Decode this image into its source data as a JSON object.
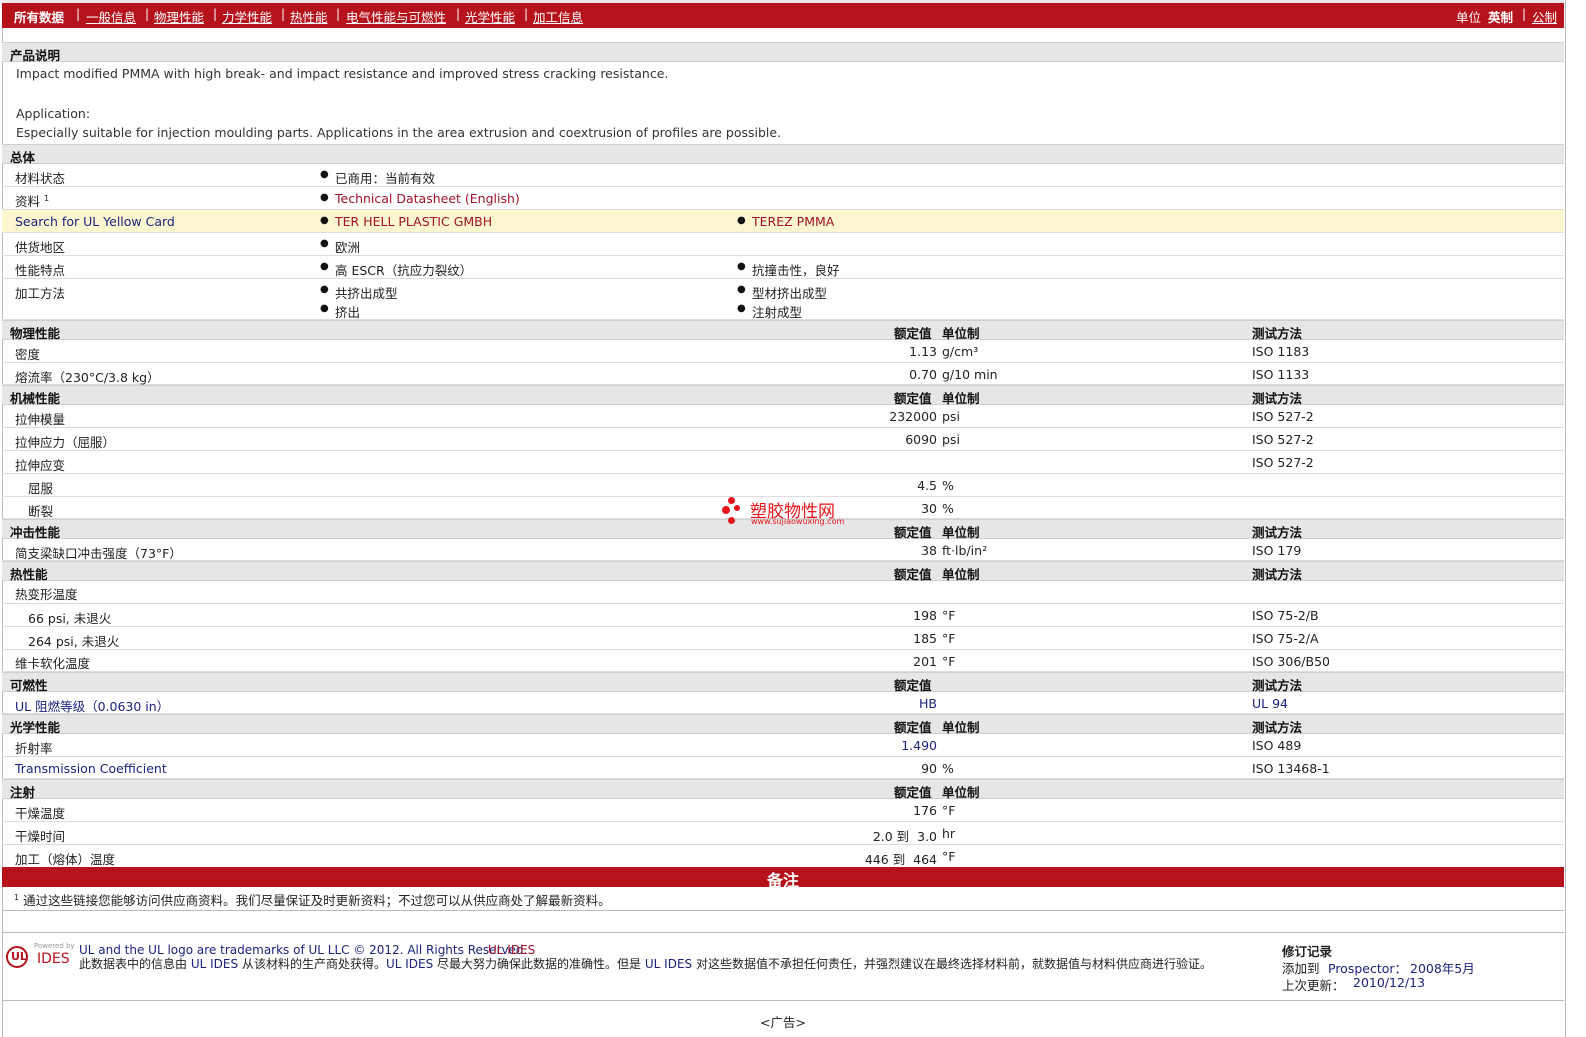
{
  "nav": {
    "items": [
      "所有数据",
      "一般信息",
      "物理性能",
      "力学性能",
      "热性能",
      "电气性能与可燃性",
      "光学性能",
      "加工信息"
    ],
    "separator": "|",
    "unit_label": "单位",
    "unit_imperial": "英制",
    "unit_metric": "公制"
  },
  "description": {
    "title": "产品说明",
    "line1": "Impact modified PMMA with high break- and impact resistance and improved stress cracking resistance.",
    "line2": "Application:",
    "line3": "Especially suitable for injection moulding parts. Applications in the area extrusion and coextrusion of profiles are possible."
  },
  "general": {
    "title": "总体",
    "rows": [
      {
        "label": "材料状态",
        "values": [
          "已商用：当前有效"
        ]
      },
      {
        "label": "资料",
        "sup": "1",
        "values": [
          "Technical Datasheet (English)"
        ]
      },
      {
        "label": "Search for UL Yellow Card",
        "values": [
          "TER HELL PLASTIC GMBH",
          "TEREZ PMMA"
        ]
      },
      {
        "label": "供货地区",
        "values": [
          "欧洲"
        ]
      },
      {
        "label": "性能特点",
        "values": [
          "高 ESCR（抗应力裂纹）",
          "抗撞击性，良好"
        ]
      },
      {
        "label": "加工方法",
        "values": [
          "共挤出成型",
          "型材挤出成型",
          "挤出",
          "注射成型"
        ]
      }
    ]
  },
  "columns": {
    "nominal": "额定值",
    "unit": "单位制",
    "method": "测试方法"
  },
  "physical": {
    "title": "物理性能",
    "rows": [
      {
        "label": "密度",
        "value": "1.13",
        "unit": "g/cm³",
        "method": "ISO 1183"
      },
      {
        "label": "熔流率（230°C/3.8 kg）",
        "value": "0.70",
        "unit": "g/10 min",
        "method": "ISO 1133"
      }
    ]
  },
  "mechanical": {
    "title": "机械性能",
    "rows": [
      {
        "label": "拉伸模量",
        "value": "232000",
        "unit": "psi",
        "method": "ISO 527-2"
      },
      {
        "label": "拉伸应力（屈服）",
        "value": "6090",
        "unit": "psi",
        "method": "ISO 527-2"
      },
      {
        "label": "拉伸应变",
        "value": "",
        "unit": "",
        "method": "ISO 527-2"
      },
      {
        "label": "屈服",
        "value": "4.5",
        "unit": "%",
        "method": ""
      },
      {
        "label": "断裂",
        "value": "30",
        "unit": "%",
        "method": ""
      }
    ]
  },
  "impact": {
    "title": "冲击性能",
    "rows": [
      {
        "label": "简支梁缺口冲击强度（73°F）",
        "value": "38",
        "unit": "ft·lb/in²",
        "method": "ISO 179"
      }
    ]
  },
  "thermal": {
    "title": "热性能",
    "rows": [
      {
        "label": "热变形温度",
        "value": "",
        "unit": "",
        "method": ""
      },
      {
        "label": "66 psi, 未退火",
        "value": "198",
        "unit": "°F",
        "method": "ISO 75-2/B"
      },
      {
        "label": "264 psi, 未退火",
        "value": "185",
        "unit": "°F",
        "method": "ISO 75-2/A"
      },
      {
        "label": "维卡软化温度",
        "value": "201",
        "unit": "°F",
        "method": "ISO 306/B50"
      }
    ]
  },
  "flammability": {
    "title": "可燃性",
    "rows": [
      {
        "label": "UL 阻燃等级（0.0630 in）",
        "value": "HB",
        "unit": "",
        "method": "UL 94"
      }
    ]
  },
  "optical": {
    "title": "光学性能",
    "rows": [
      {
        "label": "折射率",
        "value": "1.490",
        "unit": "",
        "method": "ISO 489"
      },
      {
        "label": "Transmission Coefficient",
        "value": "90",
        "unit": "%",
        "method": "ISO 13468-1"
      }
    ]
  },
  "injection": {
    "title": "注射",
    "rows": [
      {
        "label": "干燥温度",
        "value": "176",
        "unit": "°F",
        "method": ""
      },
      {
        "label": "干燥时间",
        "value": "2.0 到  3.0",
        "unit": "hr",
        "method": ""
      },
      {
        "label": "加工（熔体）温度",
        "value": "446 到  464",
        "unit": "°F",
        "method": ""
      }
    ]
  },
  "notes": {
    "title": "备注",
    "sup": "1",
    "text": "通过这些链接您能够访问供应商资料。我们尽量保证及时更新资料；不过您可以从供应商处了解最新资料。"
  },
  "watermark": {
    "cn": "塑胶物性网",
    "url": "www.sujiaowuxing.com"
  },
  "footer": {
    "powered": "Powered by",
    "logo_ul": "UL",
    "logo_ides": "IDES",
    "trademark": "UL and the UL logo are trademarks of UL LLC © 2012. All Rights Reserved.",
    "ul_ides": "UL IDES",
    "disclaimer_a": "此数据表中的信息由",
    "disclaimer_b": "从该材料的生产商处获得。",
    "disclaimer_c": "尽最大努力确保此数据的准确性。但是",
    "disclaimer_d": "对这些数据值不承担任何责任，并强烈建议在最终选择材料前，就数据值与材料供应商进行验",
    "disclaimer_e": "证。",
    "revision_title": "修订记录",
    "added_label": "添加到",
    "added_src": "Prospector：",
    "added_date": "2008年5月",
    "updated_label": "上次更新：",
    "updated_date": "2010/12/13"
  },
  "ad": "<广告>"
}
